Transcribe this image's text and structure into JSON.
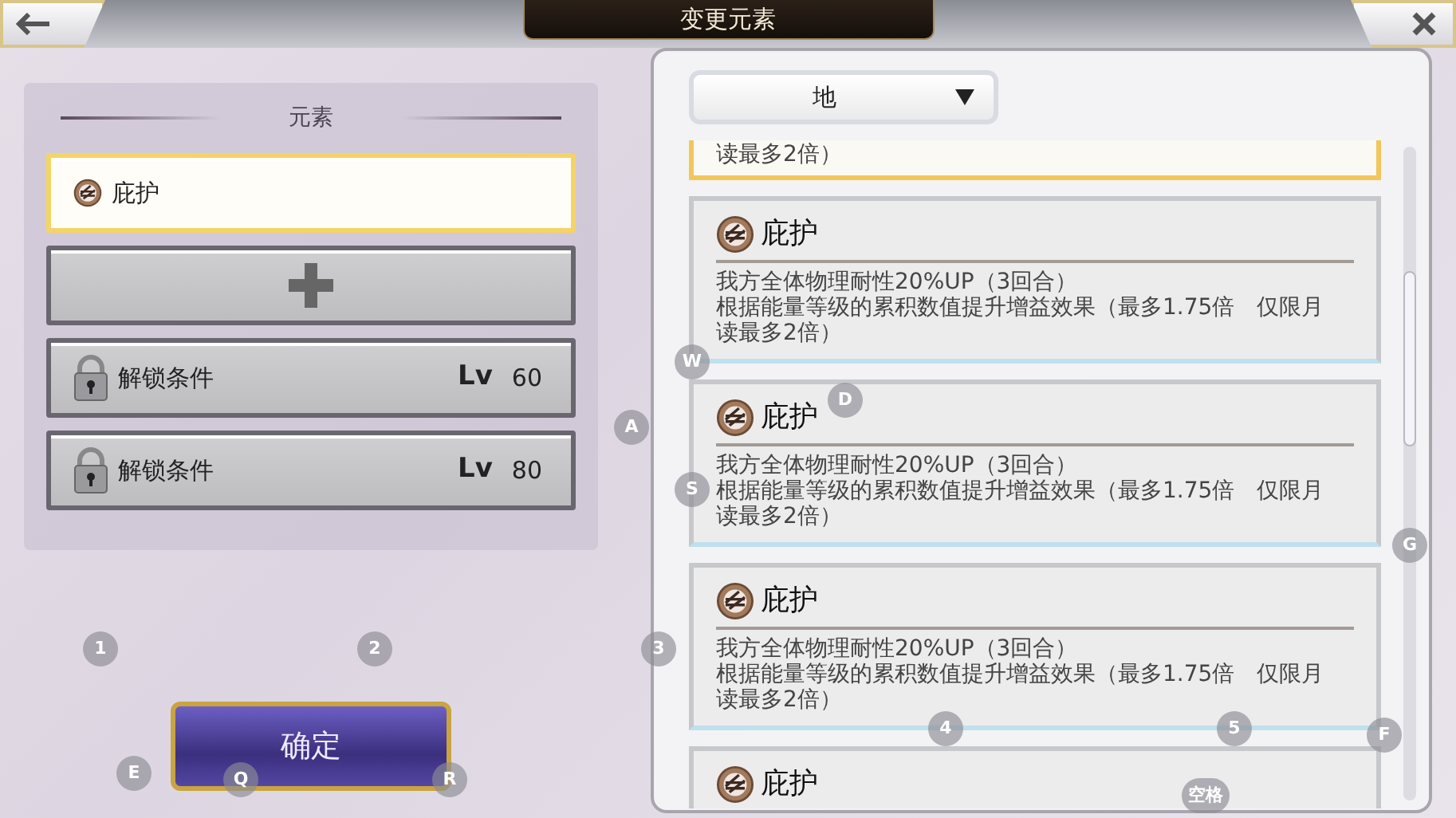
{
  "top_bar": {
    "title": "变更元素"
  },
  "left_panel": {
    "heading": "元素",
    "slots": [
      {
        "kind": "element",
        "label": "庇护",
        "selected": true
      },
      {
        "kind": "add",
        "selected": false
      },
      {
        "kind": "locked",
        "label": "解锁条件",
        "lv_label": "Lv",
        "required_level": "60",
        "selected": false
      },
      {
        "kind": "locked",
        "label": "解锁条件",
        "lv_label": "Lv",
        "required_level": "80",
        "selected": false
      }
    ]
  },
  "confirm_button": "确定",
  "right_panel": {
    "filter": {
      "value": "地"
    },
    "effects": [
      {
        "description_lines": [
          "读最多2倍）"
        ],
        "selected": true
      },
      {
        "name": "庇护",
        "description_lines": [
          "我方全体物理耐性20%UP（3回合）",
          "根据能量等级的累积数值提升增益效果（最多1.75倍　仅限月读最多2倍）"
        ],
        "selected": false
      },
      {
        "name": "庇护",
        "description_lines": [
          "我方全体物理耐性20%UP（3回合）",
          "根据能量等级的累积数值提升增益效果（最多1.75倍　仅限月读最多2倍）"
        ],
        "selected": false
      },
      {
        "name": "庇护",
        "description_lines": [
          "我方全体物理耐性20%UP（3回合）",
          "根据能量等级的累积数值提升增益效果（最多1.75倍　仅限月读最多2倍）"
        ],
        "selected": false
      },
      {
        "name": "庇护",
        "selected": false
      }
    ]
  },
  "key_hints": [
    {
      "label": "W"
    },
    {
      "label": "A"
    },
    {
      "label": "D"
    },
    {
      "label": "S"
    },
    {
      "label": "G"
    },
    {
      "label": "1"
    },
    {
      "label": "2"
    },
    {
      "label": "3"
    },
    {
      "label": "4"
    },
    {
      "label": "5"
    },
    {
      "label": "F"
    },
    {
      "label": "E"
    },
    {
      "label": "Q"
    },
    {
      "label": "R"
    },
    {
      "label": "空格"
    }
  ]
}
